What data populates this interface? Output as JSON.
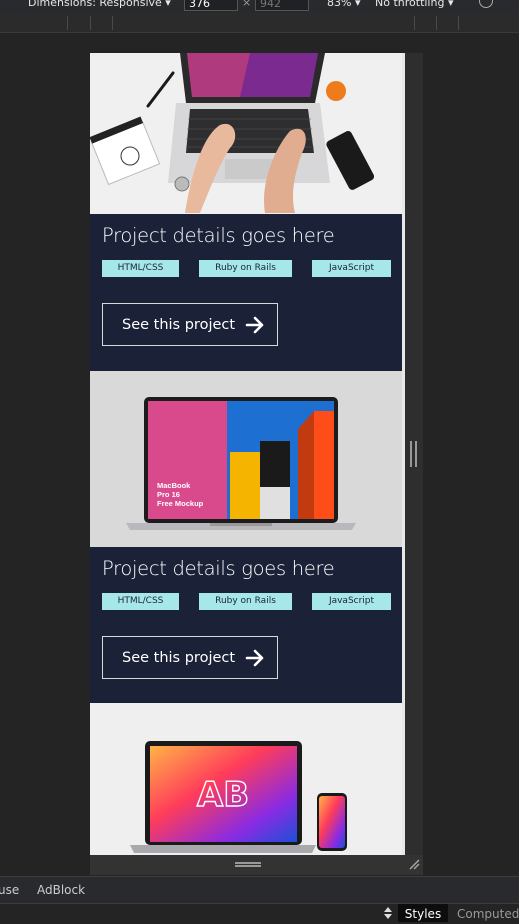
{
  "toolbar": {
    "dimensions_label": "Dimensions: Responsive ▾",
    "width_value": "376",
    "height_value": "942",
    "times_sign": "×",
    "zoom": "83% ▾",
    "throttling": "No throttling ▾"
  },
  "projects": [
    {
      "title": "Project details goes here",
      "tags": [
        "HTML/CSS",
        "Ruby on Rails",
        "JavaScript"
      ],
      "cta_label": "See this project"
    },
    {
      "title": "Project details goes here",
      "tags": [
        "HTML/CSS",
        "Ruby on Rails",
        "JavaScript"
      ],
      "cta_label": "See this project",
      "image_caption": [
        "MacBook",
        "Pro 16",
        "Free Mockup"
      ]
    },
    {
      "image_logo": "AB"
    }
  ],
  "panel": {
    "tab_use": "use",
    "tab_adblock": "AdBlock",
    "tab_styles": "Styles",
    "tab_computed": "Computed"
  },
  "colors": {
    "card_bg": "#1b2238",
    "tag_bg": "#a6e8ea",
    "devtools_bg": "#242424"
  }
}
